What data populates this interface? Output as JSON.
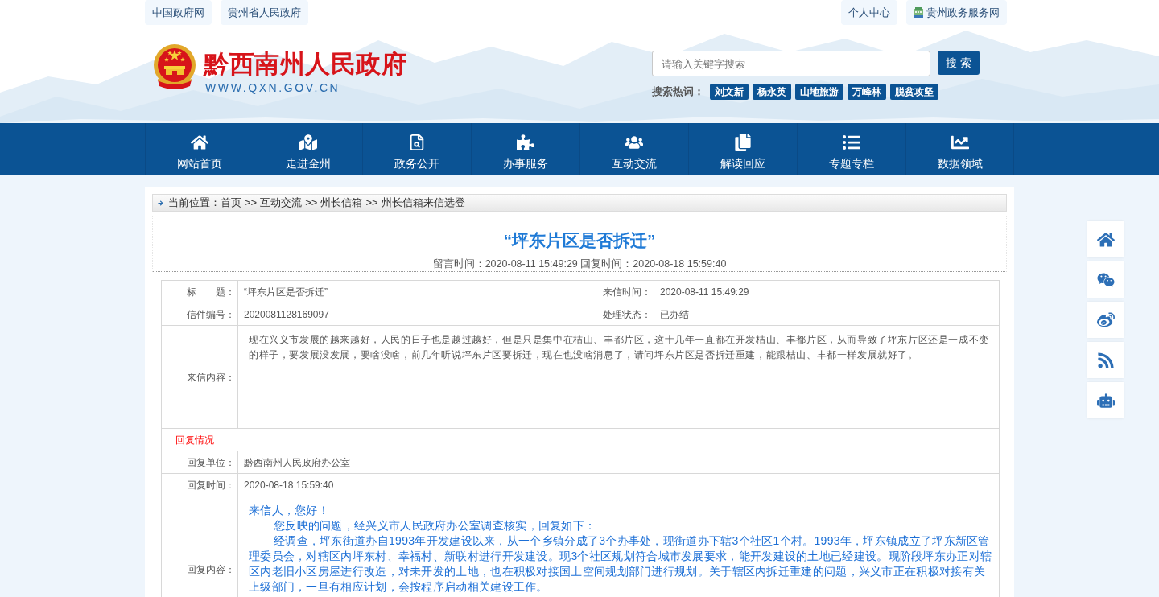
{
  "top_links": {
    "left": [
      {
        "label": "中国政府网"
      },
      {
        "label": "贵州省人民政府"
      }
    ],
    "right": [
      {
        "label": "个人中心",
        "kind": "plain"
      },
      {
        "label": "贵州政务服务网",
        "kind": "with_icon"
      }
    ]
  },
  "header": {
    "site_title": "黔西南州人民政府",
    "site_url": "WWW.QXN.GOV.CN",
    "search": {
      "placeholder": "请输入关键字搜索",
      "button": "搜 索"
    },
    "hot_words": {
      "label": "搜索热词：",
      "tags": [
        "刘文新",
        "杨永英",
        "山地旅游",
        "万峰林",
        "脱贫攻坚"
      ]
    }
  },
  "nav": [
    {
      "label": "网站首页"
    },
    {
      "label": "走进金州"
    },
    {
      "label": "政务公开"
    },
    {
      "label": "办事服务"
    },
    {
      "label": "互动交流"
    },
    {
      "label": "解读回应"
    },
    {
      "label": "专题专栏"
    },
    {
      "label": "数据领域"
    }
  ],
  "breadcrumb": {
    "label": "当前位置：",
    "items": [
      {
        "kind": "link",
        "text": "首页"
      },
      {
        "kind": "separator",
        "text": ">>"
      },
      {
        "kind": "link",
        "text": "互动交流"
      },
      {
        "kind": "separator",
        "text": ">>"
      },
      {
        "kind": "link",
        "text": "州长信箱"
      },
      {
        "kind": "separator",
        "text": ">>"
      },
      {
        "kind": "link",
        "text": "州长信箱来信选登"
      }
    ]
  },
  "article": {
    "title": "“坪东片区是否拆迁”",
    "meta": "留言时间：2020-08-11 15:49:29 回复时间：2020-08-18 15:59:40"
  },
  "letter_table": [
    {
      "kind": "pair",
      "cells": [
        {
          "label": "标　　题：",
          "value": "“坪东片区是否拆迁”"
        },
        {
          "label": "来信时间：",
          "value": "2020-08-11 15:49:29"
        }
      ]
    },
    {
      "kind": "pair",
      "cells": [
        {
          "label": "信件编号：",
          "value": "2020081128169097"
        },
        {
          "label": "处理状态：",
          "value": "已办结"
        }
      ]
    },
    {
      "kind": "body",
      "label": "来信内容：",
      "value": "现在兴义市发展的越来越好，人民的日子也是越过越好，但是只是集中在桔山、丰都片区，这十几年一直都在开发桔山、丰都片区，从而导致了坪东片区还是一成不变的样子，要发展没发展，要啥没啥，前几年听说坪东片区要拆迁，现在也没啥消息了，请问坪东片区是否拆迁重建，能跟桔山、丰都一样发展就好了。"
    },
    {
      "kind": "heading",
      "value": "回复情况"
    },
    {
      "kind": "single",
      "label": "回复单位：",
      "value": "黔西南州人民政府办公室"
    },
    {
      "kind": "single",
      "label": "回复时间：",
      "value": "2020-08-18 15:59:40"
    },
    {
      "kind": "reply",
      "label": "回复内容：",
      "paragraphs": [
        {
          "text": "来信人，您好！",
          "indent": false
        },
        {
          "text": "您反映的问题，经兴义市人民政府办公室调查核实，回复如下：",
          "indent": true
        },
        {
          "text": "经调查，坪东街道办自1993年开发建设以来，从一个乡镇分成了3个办事处，现街道办下辖3个社区1个村。1993年，坪东镇成立了坪东新区管理委员会，对辖区内坪东村、幸福村、新联村进行开发建设。现3个社区规划符合城市发展要求，能开发建设的土地已经建设。现阶段坪东办正对辖区内老旧小区房屋进行改造，对未开发的土地，也在积极对接国土空间规划部门进行规划。关于辖区内拆迁重建的问题，兴义市正在积极对接有关上级部门，一旦有相应计划，会按程序启动相关建设工作。",
          "indent": true
        }
      ]
    }
  ]
}
